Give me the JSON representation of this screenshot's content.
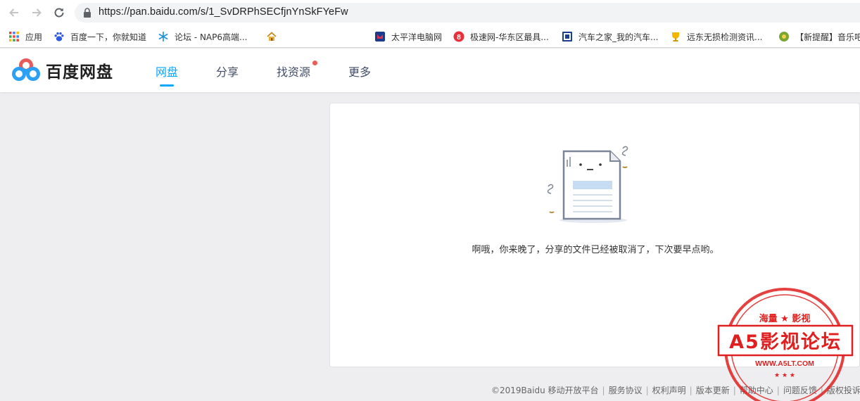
{
  "browser": {
    "url": "https://pan.baidu.com/s/1_SvDRPhSECfjnYnSkFYeFw",
    "bookmarks": [
      {
        "label": "应用",
        "icon": "apps-grid-icon"
      },
      {
        "label": "百度一下，你就知道",
        "icon": "baidu-paw-icon"
      },
      {
        "label": "论坛 - NAP6高端...",
        "icon": "snowflake-icon"
      },
      {
        "label": "",
        "icon": "home-icon"
      },
      {
        "label": "太平洋电脑网",
        "icon": "pconline-icon"
      },
      {
        "label": "极速网-华东区最具...",
        "icon": "jisu-8-icon"
      },
      {
        "label": "汽车之家_我的汽车...",
        "icon": "autohome-icon"
      },
      {
        "label": "远东无损检测资讯...",
        "icon": "trophy-icon"
      },
      {
        "label": "【新提醒】音乐吧",
        "icon": "music-icon"
      }
    ]
  },
  "site": {
    "logo_text": "百度网盘",
    "nav": [
      "网盘",
      "分享",
      "找资源",
      "更多"
    ],
    "active_nav": "网盘"
  },
  "main": {
    "message": "啊哦，你来晚了，分享的文件已经被取消了，下次要早点哟。"
  },
  "footer": {
    "copyright": "©2019Baidu",
    "links": [
      "移动开放平台",
      "服务协议",
      "权利声明",
      "版本更新",
      "帮助中心",
      "问题反馈",
      "版权投诉"
    ]
  },
  "watermark": {
    "top_text": "海量 ★ 影视",
    "main_text": "A5影视论坛",
    "url_text": "WWW.A5LT.COM"
  },
  "colors": {
    "accent": "#06a7ff",
    "nav_text": "#424e67",
    "red_dot": "#f25a5a",
    "stamp_red": "#e02020"
  }
}
